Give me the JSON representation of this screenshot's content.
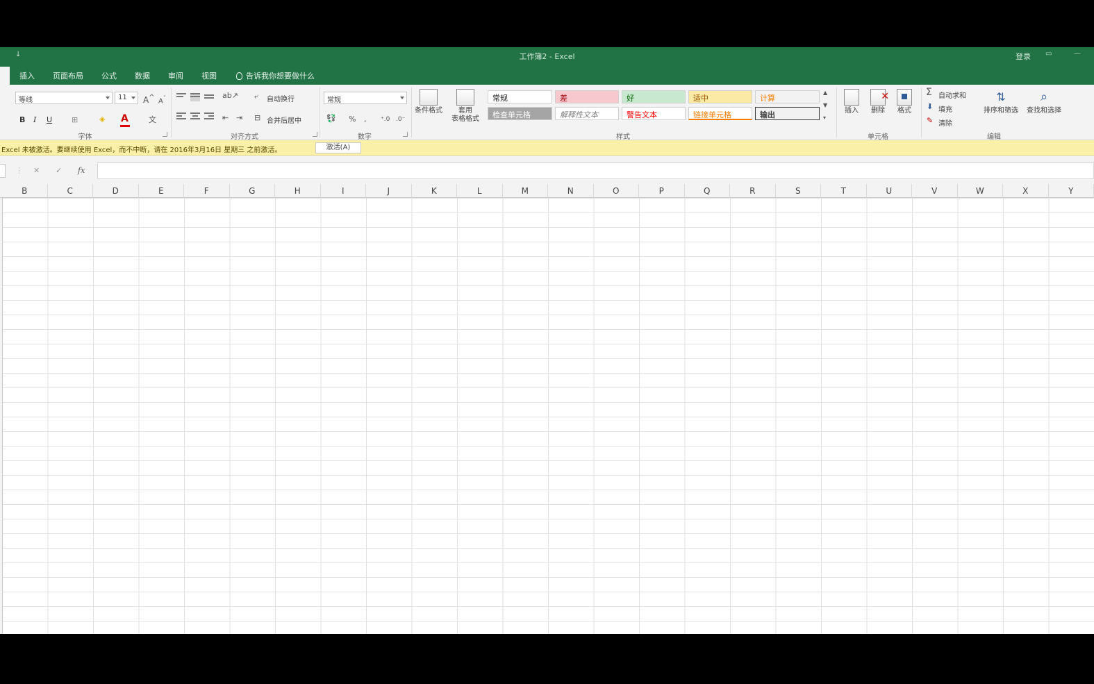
{
  "window": {
    "title": "工作簿2 - Excel",
    "login": "登录",
    "qat_glyph": "↓"
  },
  "tabs": [
    "插入",
    "页面布局",
    "公式",
    "数据",
    "审阅",
    "视图"
  ],
  "tell_me": "告诉我你想要做什么",
  "ribbon": {
    "font": {
      "font_name": "等线",
      "font_size": "11",
      "bold": "B",
      "italic": "I",
      "underline": "U",
      "font_color_glyph": "A",
      "grow_glyph": "A",
      "shrink_glyph": "A",
      "wen_glyph": "文",
      "group_label": "字体"
    },
    "alignment": {
      "wrap_text": "自动换行",
      "merge_center": "合并后居中",
      "group_label": "对齐方式"
    },
    "number": {
      "format": "常规",
      "percent": "%",
      "group_label": "数字"
    },
    "styles": {
      "conditional_format": "条件格式",
      "table_format_line1": "套用",
      "table_format_line2": "表格格式",
      "cells": [
        {
          "label": "常规",
          "bg": "#ffffff",
          "color": "#222222"
        },
        {
          "label": "差",
          "bg": "#f7c9cf",
          "color": "#9c0006"
        },
        {
          "label": "好",
          "bg": "#c8e8cf",
          "color": "#006100"
        },
        {
          "label": "适中",
          "bg": "#fbe9a6",
          "color": "#9c5700"
        },
        {
          "label": "计算",
          "bg": "#f2f2f2",
          "color": "#fa7d00"
        },
        {
          "label": "检查单元格",
          "bg": "#a5a5a5",
          "color": "#ffffff"
        },
        {
          "label": "解释性文本",
          "bg": "#ffffff",
          "color": "#7f7f7f"
        },
        {
          "label": "警告文本",
          "bg": "#ffffff",
          "color": "#ff0000"
        },
        {
          "label": "链接单元格",
          "bg": "#ffffff",
          "color": "#fa7d00"
        },
        {
          "label": "输出",
          "bg": "#f2f2f2",
          "color": "#3f3f3f"
        }
      ],
      "group_label": "样式"
    },
    "cells": {
      "insert": "插入",
      "delete": "删除",
      "format": "格式",
      "group_label": "单元格"
    },
    "editing": {
      "autosum": "自动求和",
      "fill": "填充",
      "clear": "清除",
      "sort_filter": "排序和筛选",
      "find_select": "查找和选择",
      "sigma": "Σ",
      "group_label": "编辑"
    }
  },
  "notice": {
    "message": "Excel 未被激活。要继续使用 Excel，而不中断，请在 2016年3月16日 星期三 之前激活。",
    "button": "激活(A)"
  },
  "formula_bar": {
    "cancel": "✕",
    "enter": "✓",
    "fx": "fx",
    "value": ""
  },
  "columns": [
    "B",
    "C",
    "D",
    "E",
    "F",
    "G",
    "H",
    "I",
    "J",
    "K",
    "L",
    "M",
    "N",
    "O",
    "P",
    "Q",
    "R",
    "S",
    "T",
    "U",
    "V",
    "W",
    "X",
    "Y"
  ],
  "colors": {
    "excel_green": "#217346",
    "notice_bg": "#fbf0a8"
  }
}
